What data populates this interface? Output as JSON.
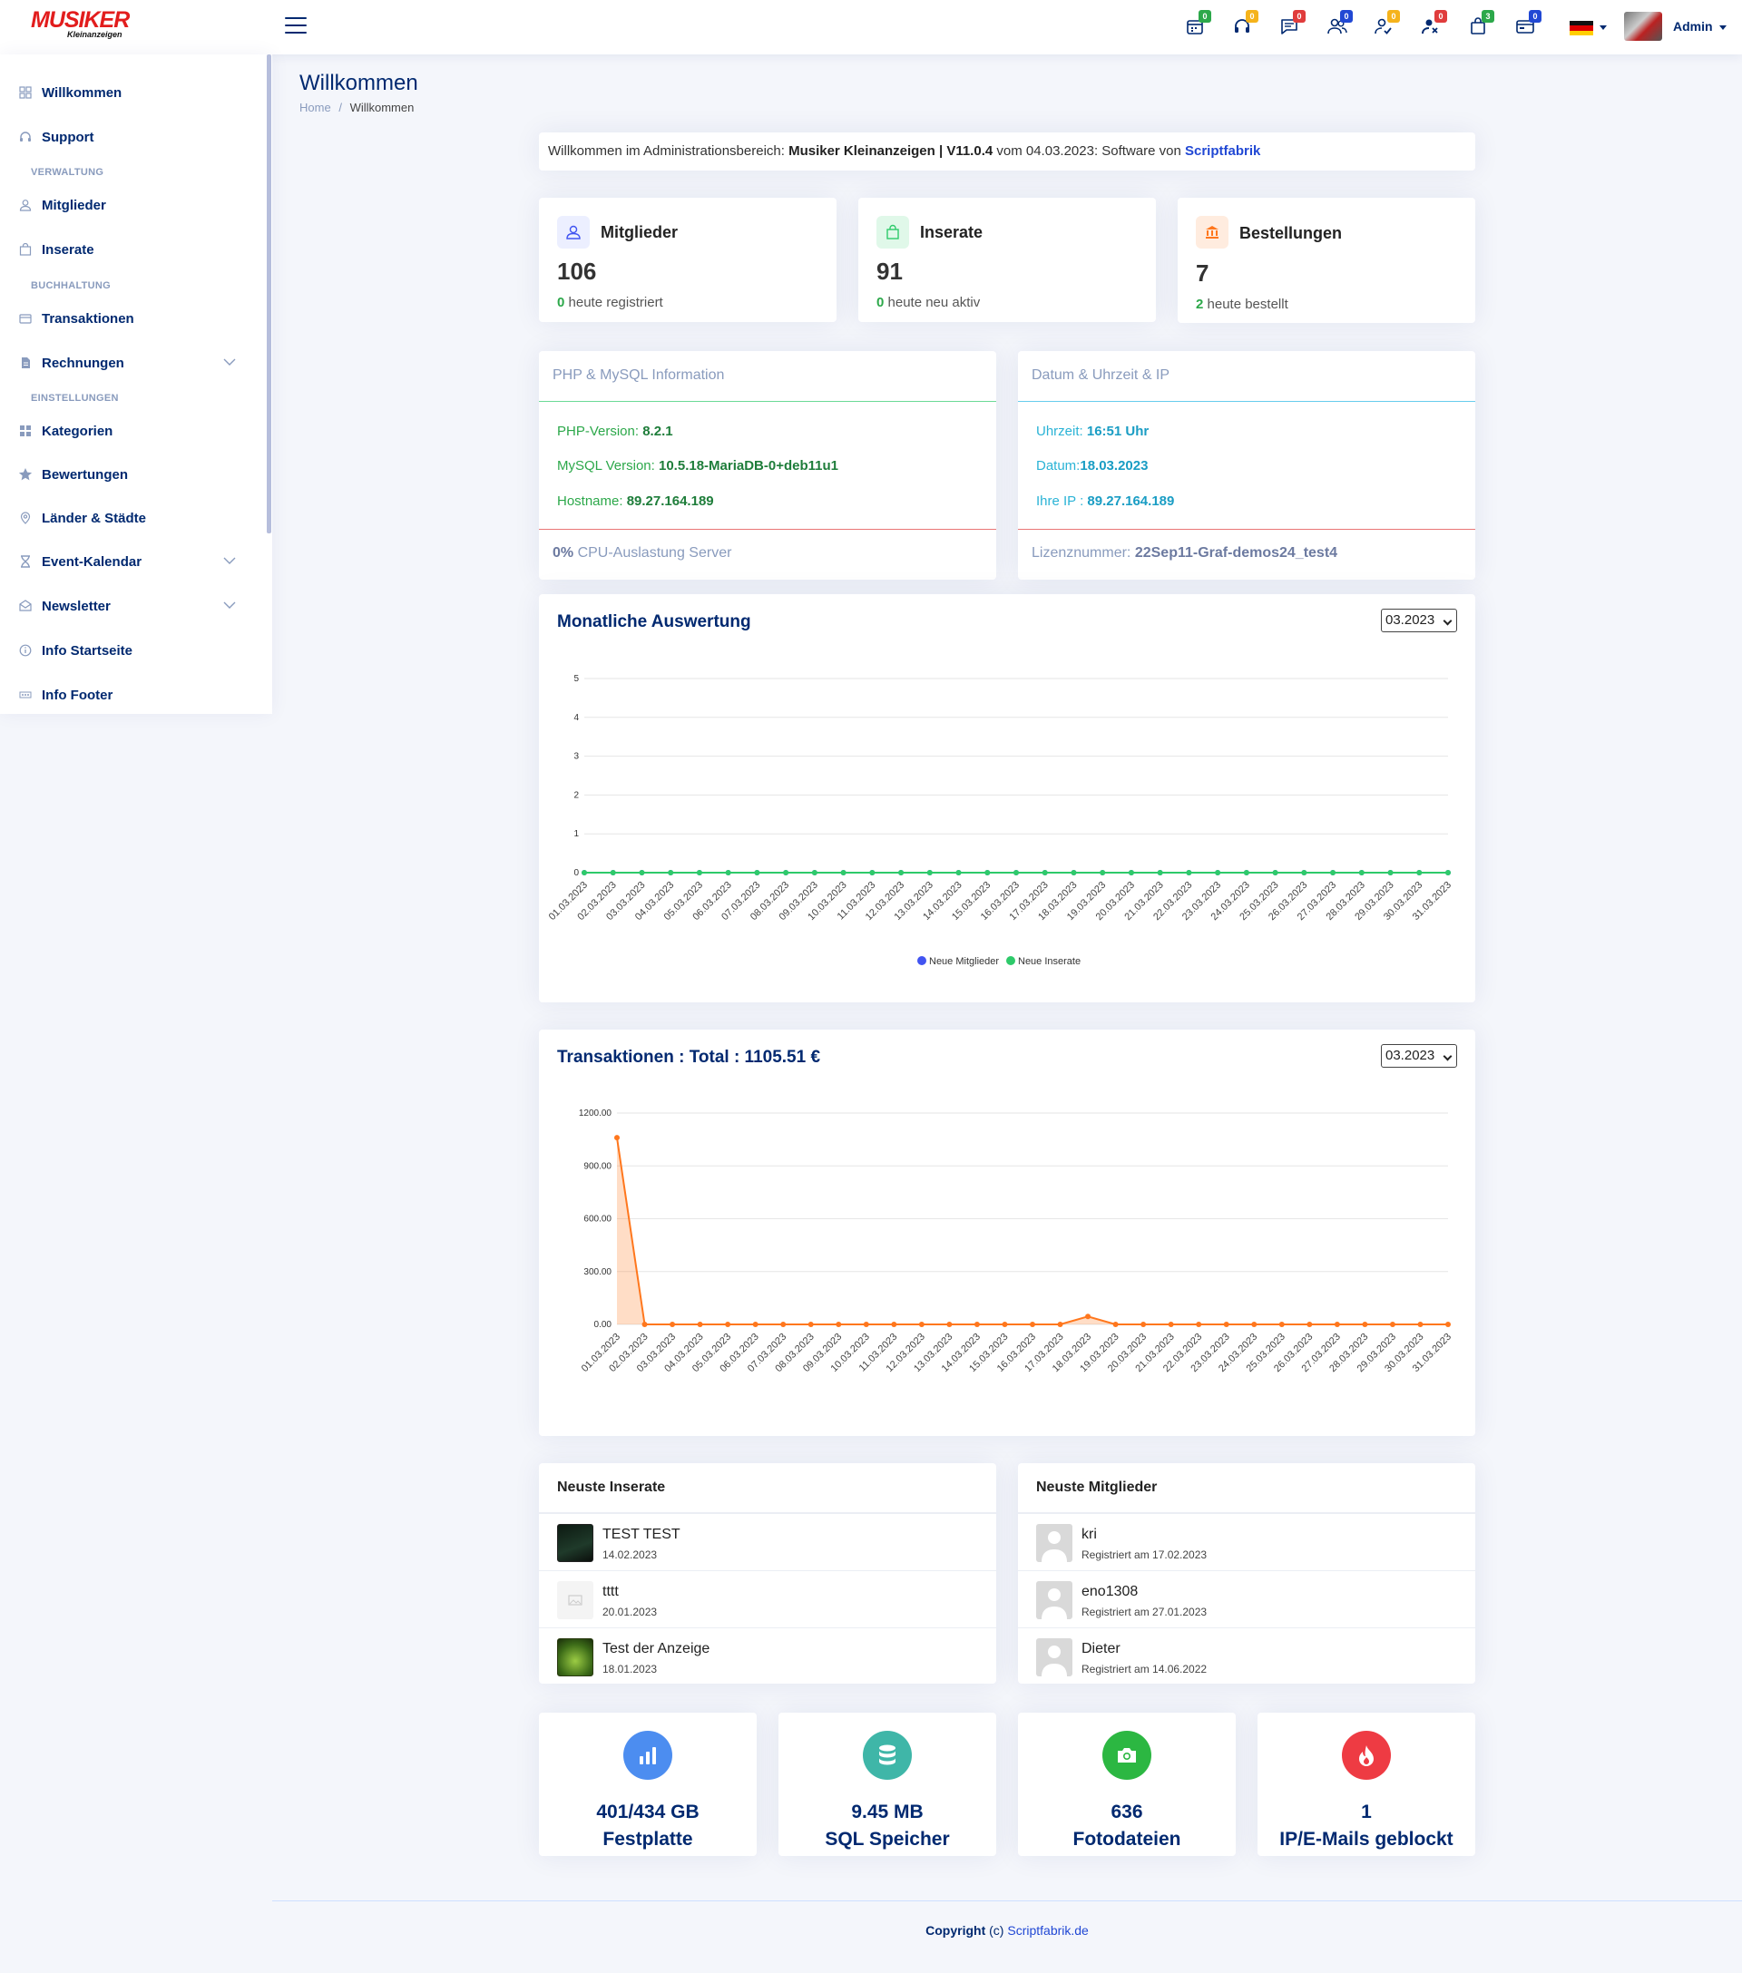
{
  "header": {
    "logo_main": "MUSIKER",
    "logo_sub": "Kleinanzeigen",
    "icons": [
      {
        "name": "calendar-icon",
        "badge": "0",
        "badge_color": "#2ca84a"
      },
      {
        "name": "headset-icon",
        "badge": "0",
        "badge_color": "#f5b31b"
      },
      {
        "name": "chat-icon",
        "badge": "0",
        "badge_color": "#e03c3c"
      },
      {
        "name": "users-icon",
        "badge": "0",
        "badge_color": "#2148d4"
      },
      {
        "name": "user-check-icon",
        "badge": "0",
        "badge_color": "#f5b31b"
      },
      {
        "name": "user-x-icon",
        "badge": "0",
        "badge_color": "#e03c3c"
      },
      {
        "name": "bag-icon",
        "badge": "3",
        "badge_color": "#2ca84a"
      },
      {
        "name": "card-icon",
        "badge": "0",
        "badge_color": "#2148d4"
      }
    ],
    "user": "Admin"
  },
  "sidebar": {
    "items": [
      {
        "label": "Willkommen",
        "icon": "grid-icon"
      },
      {
        "label": "Support",
        "icon": "headset-icon"
      },
      {
        "label": "Mitglieder",
        "icon": "person-icon"
      },
      {
        "label": "Inserate",
        "icon": "bag-icon"
      },
      {
        "label": "Transaktionen",
        "icon": "card-icon"
      },
      {
        "label": "Rechnungen",
        "icon": "document-icon"
      },
      {
        "label": "Kategorien",
        "icon": "grid-fill-icon"
      },
      {
        "label": "Bewertungen",
        "icon": "star-icon"
      },
      {
        "label": "Länder & Städte",
        "icon": "pin-icon"
      },
      {
        "label": "Event-Kalendar",
        "icon": "hourglass-icon"
      },
      {
        "label": "Newsletter",
        "icon": "envelope-icon"
      },
      {
        "label": "Info Startseite",
        "icon": "info-icon"
      },
      {
        "label": "Info Footer",
        "icon": "dots-icon"
      }
    ],
    "headings": [
      "VERWALTUNG",
      "BUCHHALTUNG",
      "EINSTELLUNGEN"
    ]
  },
  "page": {
    "title": "Willkommen",
    "breadcrumb_home": "Home",
    "breadcrumb_sep": "/",
    "breadcrumb_current": "Willkommen"
  },
  "welcome": {
    "prefix": "Willkommen im Administrationsbereich: ",
    "product": "Musiker Kleinanzeigen | V11.0.4",
    "middle": " vom 04.03.2023: Software von ",
    "link": "Scriptfabrik"
  },
  "stats": [
    {
      "title": "Mitglieder",
      "value": "106",
      "sub_num": "0",
      "sub_text": " heute registriert"
    },
    {
      "title": "Inserate",
      "value": "91",
      "sub_num": "0",
      "sub_text": " heute neu aktiv"
    },
    {
      "title": "Bestellungen",
      "value": "7",
      "sub_num": "2",
      "sub_text": " heute bestellt"
    }
  ],
  "php_info": {
    "header": "PHP & MySQL Information",
    "rows": [
      {
        "label": "PHP-Version: ",
        "value": "8.2.1"
      },
      {
        "label": "MySQL Version: ",
        "value": "10.5.18-MariaDB-0+deb11u1"
      },
      {
        "label": "Hostname: ",
        "value": "89.27.164.189"
      }
    ],
    "footer_value": "0%",
    "footer_text": " CPU-Auslastung Server"
  },
  "date_info": {
    "header": "Datum & Uhrzeit & IP",
    "rows": [
      {
        "label": "Uhrzeit: ",
        "value": "16:51 Uhr"
      },
      {
        "label": "Datum:",
        "value": "18.03.2023"
      },
      {
        "label": "Ihre IP : ",
        "value": "89.27.164.189"
      }
    ],
    "footer_label": "Lizenznummer: ",
    "footer_value": "22Sep11-Graf-demos24_test4"
  },
  "chart_monthly": {
    "title": "Monatliche Auswertung",
    "select": "03.2023"
  },
  "chart_trans": {
    "title": "Transaktionen : Total : 1105.51 €",
    "select": "03.2023"
  },
  "chart_data": [
    {
      "type": "line",
      "x": [
        "01.03.2023",
        "02.03.2023",
        "03.03.2023",
        "04.03.2023",
        "05.03.2023",
        "06.03.2023",
        "07.03.2023",
        "08.03.2023",
        "09.03.2023",
        "10.03.2023",
        "11.03.2023",
        "12.03.2023",
        "13.03.2023",
        "14.03.2023",
        "15.03.2023",
        "16.03.2023",
        "17.03.2023",
        "18.03.2023",
        "19.03.2023",
        "20.03.2023",
        "21.03.2023",
        "22.03.2023",
        "23.03.2023",
        "24.03.2023",
        "25.03.2023",
        "26.03.2023",
        "27.03.2023",
        "28.03.2023",
        "29.03.2023",
        "30.03.2023",
        "31.03.2023"
      ],
      "series": [
        {
          "name": "Neue Mitglieder",
          "color": "#4154f1",
          "values": [
            0,
            0,
            0,
            0,
            0,
            0,
            0,
            0,
            0,
            0,
            0,
            0,
            0,
            0,
            0,
            0,
            0,
            0,
            0,
            0,
            0,
            0,
            0,
            0,
            0,
            0,
            0,
            0,
            0,
            0,
            0
          ]
        },
        {
          "name": "Neue Inserate",
          "color": "#2eca6a",
          "values": [
            0,
            0,
            0,
            0,
            0,
            0,
            0,
            0,
            0,
            0,
            0,
            0,
            0,
            0,
            0,
            0,
            0,
            0,
            0,
            0,
            0,
            0,
            0,
            0,
            0,
            0,
            0,
            0,
            0,
            0,
            0
          ]
        }
      ],
      "yticks": [
        "0",
        "1",
        "2",
        "3",
        "4",
        "5"
      ],
      "ylim": [
        0,
        5
      ],
      "grid": true,
      "legend": "bottom"
    },
    {
      "type": "area",
      "x": [
        "01.03.2023",
        "02.03.2023",
        "03.03.2023",
        "04.03.2023",
        "05.03.2023",
        "06.03.2023",
        "07.03.2023",
        "08.03.2023",
        "09.03.2023",
        "10.03.2023",
        "11.03.2023",
        "12.03.2023",
        "13.03.2023",
        "14.03.2023",
        "15.03.2023",
        "16.03.2023",
        "17.03.2023",
        "18.03.2023",
        "19.03.2023",
        "20.03.2023",
        "21.03.2023",
        "22.03.2023",
        "23.03.2023",
        "24.03.2023",
        "25.03.2023",
        "26.03.2023",
        "27.03.2023",
        "28.03.2023",
        "29.03.2023",
        "30.03.2023",
        "31.03.2023"
      ],
      "series": [
        {
          "color": "#ff771d",
          "values": [
            1060,
            0,
            0,
            0,
            0,
            0,
            0,
            0,
            0,
            0,
            0,
            0,
            0,
            0,
            0,
            0,
            0,
            45,
            0,
            0,
            0,
            0,
            0,
            0,
            0,
            0,
            0,
            0,
            0,
            0,
            0
          ]
        }
      ],
      "yticks": [
        "0.00",
        "300.00",
        "600.00",
        "900.00",
        "1200.00"
      ],
      "ylim": [
        0,
        1200
      ],
      "grid": true
    }
  ],
  "latest_ads": {
    "header": "Neuste Inserate",
    "items": [
      {
        "name": "TEST TEST",
        "date": "14.02.2023"
      },
      {
        "name": "tttt",
        "date": "20.01.2023"
      },
      {
        "name": "Test der Anzeige",
        "date": "18.01.2023"
      }
    ]
  },
  "latest_members": {
    "header": "Neuste Mitglieder",
    "items": [
      {
        "name": "kri",
        "date": "Registriert am 17.02.2023"
      },
      {
        "name": "eno1308",
        "date": "Registriert am 27.01.2023"
      },
      {
        "name": "Dieter",
        "date": "Registriert am 14.06.2022"
      }
    ]
  },
  "bottom_stats": [
    {
      "v1": "401/434 GB",
      "v2": "Festplatte",
      "color": "#4c8df0",
      "icon": "bar-chart-icon"
    },
    {
      "v1": "9.45 MB",
      "v2": "SQL Speicher",
      "color": "#3fb6a8",
      "icon": "database-icon"
    },
    {
      "v1": "636",
      "v2": "Fotodateien",
      "color": "#2cb742",
      "icon": "camera-icon"
    },
    {
      "v1": "1",
      "v2": "IP/E-Mails geblockt",
      "color": "#ee3b43",
      "icon": "fire-icon"
    }
  ],
  "footer": {
    "copy": "Copyright",
    "by": " (c) ",
    "link": "Scriptfabrik.de"
  }
}
